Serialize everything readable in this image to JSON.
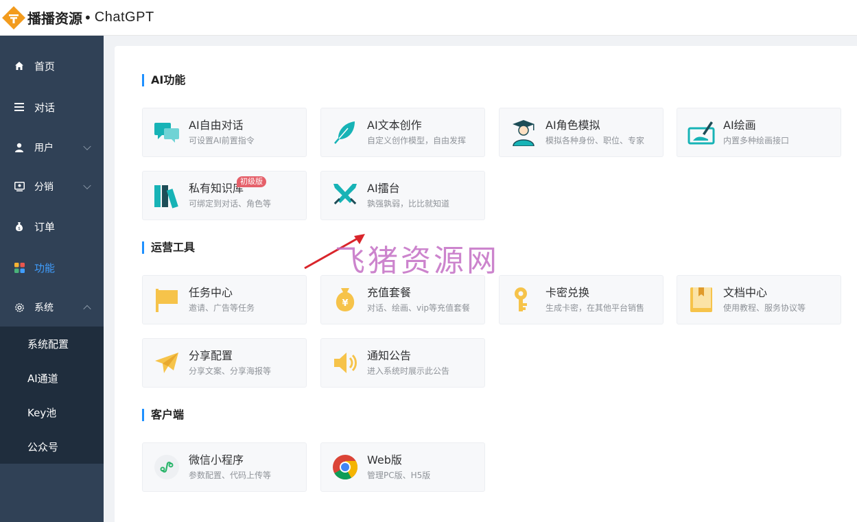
{
  "header": {
    "brand_cn": "播播资源",
    "brand_dot": "•",
    "brand_en": "ChatGPT"
  },
  "sidebar": {
    "items": [
      {
        "label": "首页",
        "icon": "home-icon"
      },
      {
        "label": "对话",
        "icon": "list-icon"
      },
      {
        "label": "用户",
        "icon": "user-icon"
      },
      {
        "label": "分销",
        "icon": "distribution-icon"
      },
      {
        "label": "订单",
        "icon": "money-bag-icon"
      },
      {
        "label": "功能",
        "icon": "apps-icon",
        "active": true
      },
      {
        "label": "系统",
        "icon": "settings-icon"
      }
    ],
    "submenu": [
      "系统配置",
      "AI通道",
      "Key池",
      "公众号"
    ]
  },
  "sections": {
    "ai": {
      "title": "AI功能"
    },
    "ops": {
      "title": "运营工具"
    },
    "client": {
      "title": "客户端"
    }
  },
  "cards": {
    "ai_chat": {
      "title": "AI自由对话",
      "desc": "可设置AI前置指令",
      "icon": "chat-bubbles-icon"
    },
    "ai_write": {
      "title": "AI文本创作",
      "desc": "自定义创作模型，自由发挥",
      "icon": "feather-icon"
    },
    "ai_role": {
      "title": "AI角色模拟",
      "desc": "模拟各种身份、职位、专家",
      "icon": "graduate-icon"
    },
    "ai_draw": {
      "title": "AI绘画",
      "desc": "内置多种绘画接口",
      "icon": "drawing-board-icon"
    },
    "kb": {
      "title": "私有知识库",
      "desc": "可绑定到对话、角色等",
      "badge": "初级版",
      "icon": "books-icon"
    },
    "arena": {
      "title": "AI擂台",
      "desc": "孰强孰弱，比比就知道",
      "icon": "crossed-swords-icon"
    },
    "task": {
      "title": "任务中心",
      "desc": "邀请、广告等任务",
      "icon": "flag-icon"
    },
    "recharge": {
      "title": "充值套餐",
      "desc": "对话、绘画、vip等充值套餐",
      "icon": "yen-bag-icon"
    },
    "card_key": {
      "title": "卡密兑换",
      "desc": "生成卡密，在其他平台销售",
      "icon": "key-icon"
    },
    "docs": {
      "title": "文档中心",
      "desc": "使用教程、服务协议等",
      "icon": "book-icon"
    },
    "share": {
      "title": "分享配置",
      "desc": "分享文案、分享海报等",
      "icon": "paper-plane-icon"
    },
    "notice": {
      "title": "通知公告",
      "desc": "进入系统时展示此公告",
      "icon": "speaker-icon"
    },
    "mini": {
      "title": "微信小程序",
      "desc": "参数配置、代码上传等",
      "icon": "mini-program-icon"
    },
    "web": {
      "title": "Web版",
      "desc": "管理PC版、H5版",
      "icon": "chrome-icon"
    }
  },
  "watermark": "飞猪资源网",
  "colors": {
    "accent": "#409eff",
    "sidebar": "#304156",
    "submenu": "#1f2d3d",
    "teal": "#17b3b6",
    "yellow": "#f6c34a",
    "badge": "#e5606a"
  }
}
